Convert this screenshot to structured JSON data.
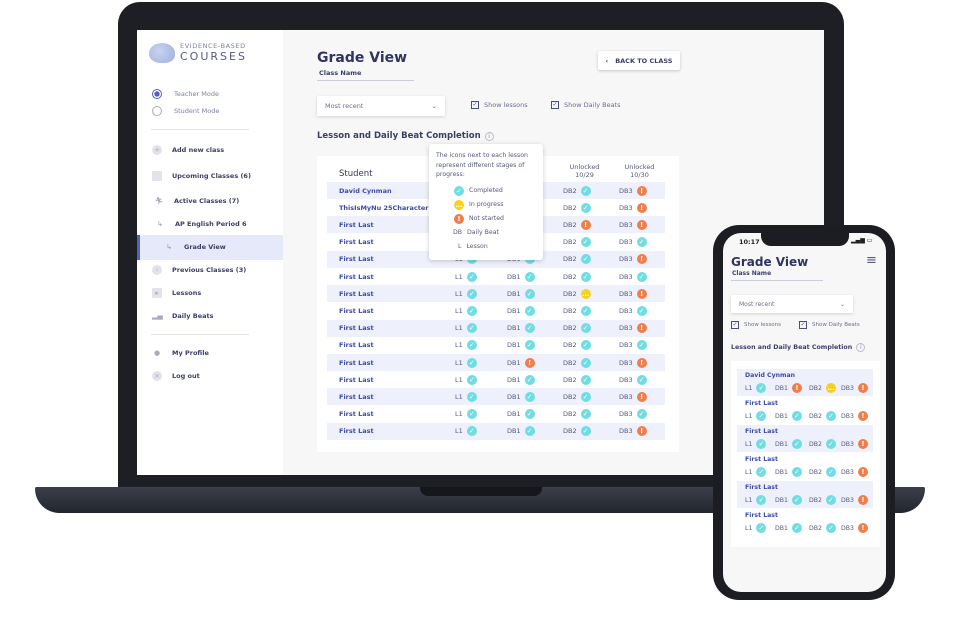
{
  "laptop": {
    "brand": {
      "line1": "EVIDENCE-BASED",
      "line2": "COURSES"
    },
    "modes": [
      {
        "label": "Teacher Mode",
        "selected": true
      },
      {
        "label": "Student Mode",
        "selected": false
      }
    ],
    "nav": [
      {
        "label": "Add new class",
        "icon": "plus-circle-icon"
      },
      {
        "label": "Upcoming Classes (6)",
        "icon": "calendar-icon"
      },
      {
        "label": "Active Classes (7)",
        "icon": "runner-icon"
      },
      {
        "label": "AP English Period 6",
        "icon": "sub-arrow-icon"
      },
      {
        "label": "Grade View",
        "icon": "sub-arrow-icon",
        "active": true
      },
      {
        "label": "Previous Classes (3)",
        "icon": "back-circle-icon"
      },
      {
        "label": "Lessons",
        "icon": "play-icon"
      },
      {
        "label": "Daily Beats",
        "icon": "bar-chart-icon"
      },
      {
        "label": "My Profile",
        "icon": "user-icon"
      },
      {
        "label": "Log out",
        "icon": "close-circle-icon"
      }
    ],
    "title": "Grade View",
    "class_name": "Class Name",
    "back_button": "BACK TO CLASS",
    "sort_select": "Most recent",
    "show_lessons": "Show lessons",
    "show_daily_beats": "Show Daily Beats",
    "section_title": "Lesson and Daily Beat Completion",
    "columns": {
      "student": "Student",
      "col3": "Unlocked\n10/29",
      "col4": "Unlocked\n10/30"
    },
    "rows": [
      {
        "name": "David Cynman",
        "cells": [
          [
            "L1",
            "c"
          ],
          [
            "DB1",
            "c"
          ],
          [
            "DB2",
            "c"
          ],
          [
            "DB3",
            "n"
          ]
        ]
      },
      {
        "name": "ThisIsMyNu 25CharacterN",
        "cells": [
          [
            "L1",
            "c"
          ],
          [
            "DB1",
            "c"
          ],
          [
            "DB2",
            "c"
          ],
          [
            "DB3",
            "n"
          ]
        ]
      },
      {
        "name": "First Last",
        "cells": [
          [
            "L1",
            "c"
          ],
          [
            "DB1",
            "c"
          ],
          [
            "DB2",
            "n"
          ],
          [
            "DB3",
            "n"
          ]
        ]
      },
      {
        "name": "First Last",
        "cells": [
          [
            "L1",
            "c"
          ],
          [
            "DB1",
            "c"
          ],
          [
            "DB2",
            "c"
          ],
          [
            "DB3",
            "c"
          ]
        ]
      },
      {
        "name": "First Last",
        "cells": [
          [
            "L1",
            "c"
          ],
          [
            "DB1",
            "c"
          ],
          [
            "DB2",
            "c"
          ],
          [
            "DB3",
            "n"
          ]
        ]
      },
      {
        "name": "First Last",
        "cells": [
          [
            "L1",
            "c"
          ],
          [
            "DB1",
            "c"
          ],
          [
            "DB2",
            "c"
          ],
          [
            "DB3",
            "c"
          ]
        ]
      },
      {
        "name": "First Last",
        "cells": [
          [
            "L1",
            "c"
          ],
          [
            "DB1",
            "c"
          ],
          [
            "DB2",
            "p"
          ],
          [
            "DB3",
            "n"
          ]
        ]
      },
      {
        "name": "First Last",
        "cells": [
          [
            "L1",
            "c"
          ],
          [
            "DB1",
            "c"
          ],
          [
            "DB2",
            "c"
          ],
          [
            "DB3",
            "c"
          ]
        ]
      },
      {
        "name": "First Last",
        "cells": [
          [
            "L1",
            "c"
          ],
          [
            "DB1",
            "c"
          ],
          [
            "DB2",
            "c"
          ],
          [
            "DB3",
            "n"
          ]
        ]
      },
      {
        "name": "First Last",
        "cells": [
          [
            "L1",
            "c"
          ],
          [
            "DB1",
            "c"
          ],
          [
            "DB2",
            "c"
          ],
          [
            "DB3",
            "c"
          ]
        ]
      },
      {
        "name": "First Last",
        "cells": [
          [
            "L1",
            "c"
          ],
          [
            "DB1",
            "n"
          ],
          [
            "DB2",
            "c"
          ],
          [
            "DB3",
            "n"
          ]
        ]
      },
      {
        "name": "First Last",
        "cells": [
          [
            "L1",
            "c"
          ],
          [
            "DB1",
            "c"
          ],
          [
            "DB2",
            "c"
          ],
          [
            "DB3",
            "c"
          ]
        ]
      },
      {
        "name": "First Last",
        "cells": [
          [
            "L1",
            "c"
          ],
          [
            "DB1",
            "c"
          ],
          [
            "DB2",
            "c"
          ],
          [
            "DB3",
            "n"
          ]
        ]
      },
      {
        "name": "First Last",
        "cells": [
          [
            "L1",
            "c"
          ],
          [
            "DB1",
            "c"
          ],
          [
            "DB2",
            "c"
          ],
          [
            "DB3",
            "c"
          ]
        ]
      },
      {
        "name": "First Last",
        "cells": [
          [
            "L1",
            "c"
          ],
          [
            "DB1",
            "c"
          ],
          [
            "DB2",
            "c"
          ],
          [
            "DB3",
            "n"
          ]
        ]
      }
    ],
    "tooltip": {
      "intro": "The icons next to each lesson represent different stages of progress:",
      "completed": "Completed",
      "in_progress": "In progress",
      "not_started": "Not started",
      "db_abbr": "DB",
      "db_label": "Daily Beat",
      "l_abbr": "L",
      "l_label": "Lesson"
    }
  },
  "phone": {
    "time": "10:17",
    "title": "Grade View",
    "class_name": "Class Name",
    "sort_select": "Most recent",
    "show_lessons": "Show lessons",
    "show_daily_beats": "Show Daily Beats",
    "section_title": "Lesson and Daily Beat Completion",
    "rows": [
      {
        "name": "David Cynman",
        "cells": [
          [
            "L1",
            "c"
          ],
          [
            "DB1",
            "n"
          ],
          [
            "DB2",
            "p"
          ],
          [
            "DB3",
            "n"
          ]
        ]
      },
      {
        "name": "First Last",
        "cells": [
          [
            "L1",
            "c"
          ],
          [
            "DB1",
            "c"
          ],
          [
            "DB2",
            "c"
          ],
          [
            "DB3",
            "n"
          ]
        ]
      },
      {
        "name": "First Last",
        "cells": [
          [
            "L1",
            "c"
          ],
          [
            "DB1",
            "c"
          ],
          [
            "DB2",
            "c"
          ],
          [
            "DB3",
            "n"
          ]
        ]
      },
      {
        "name": "First Last",
        "cells": [
          [
            "L1",
            "c"
          ],
          [
            "DB1",
            "c"
          ],
          [
            "DB2",
            "c"
          ],
          [
            "DB3",
            "n"
          ]
        ]
      },
      {
        "name": "First Last",
        "cells": [
          [
            "L1",
            "c"
          ],
          [
            "DB1",
            "c"
          ],
          [
            "DB2",
            "c"
          ],
          [
            "DB3",
            "n"
          ]
        ]
      },
      {
        "name": "First Last",
        "cells": [
          [
            "L1",
            "c"
          ],
          [
            "DB1",
            "c"
          ],
          [
            "DB2",
            "c"
          ],
          [
            "DB3",
            "n"
          ]
        ]
      }
    ]
  },
  "status_colors": {
    "completed": "#6fdde3",
    "in_progress": "#f6d11f",
    "not_started": "#ef7e4a",
    "accent": "#4f61c7"
  }
}
